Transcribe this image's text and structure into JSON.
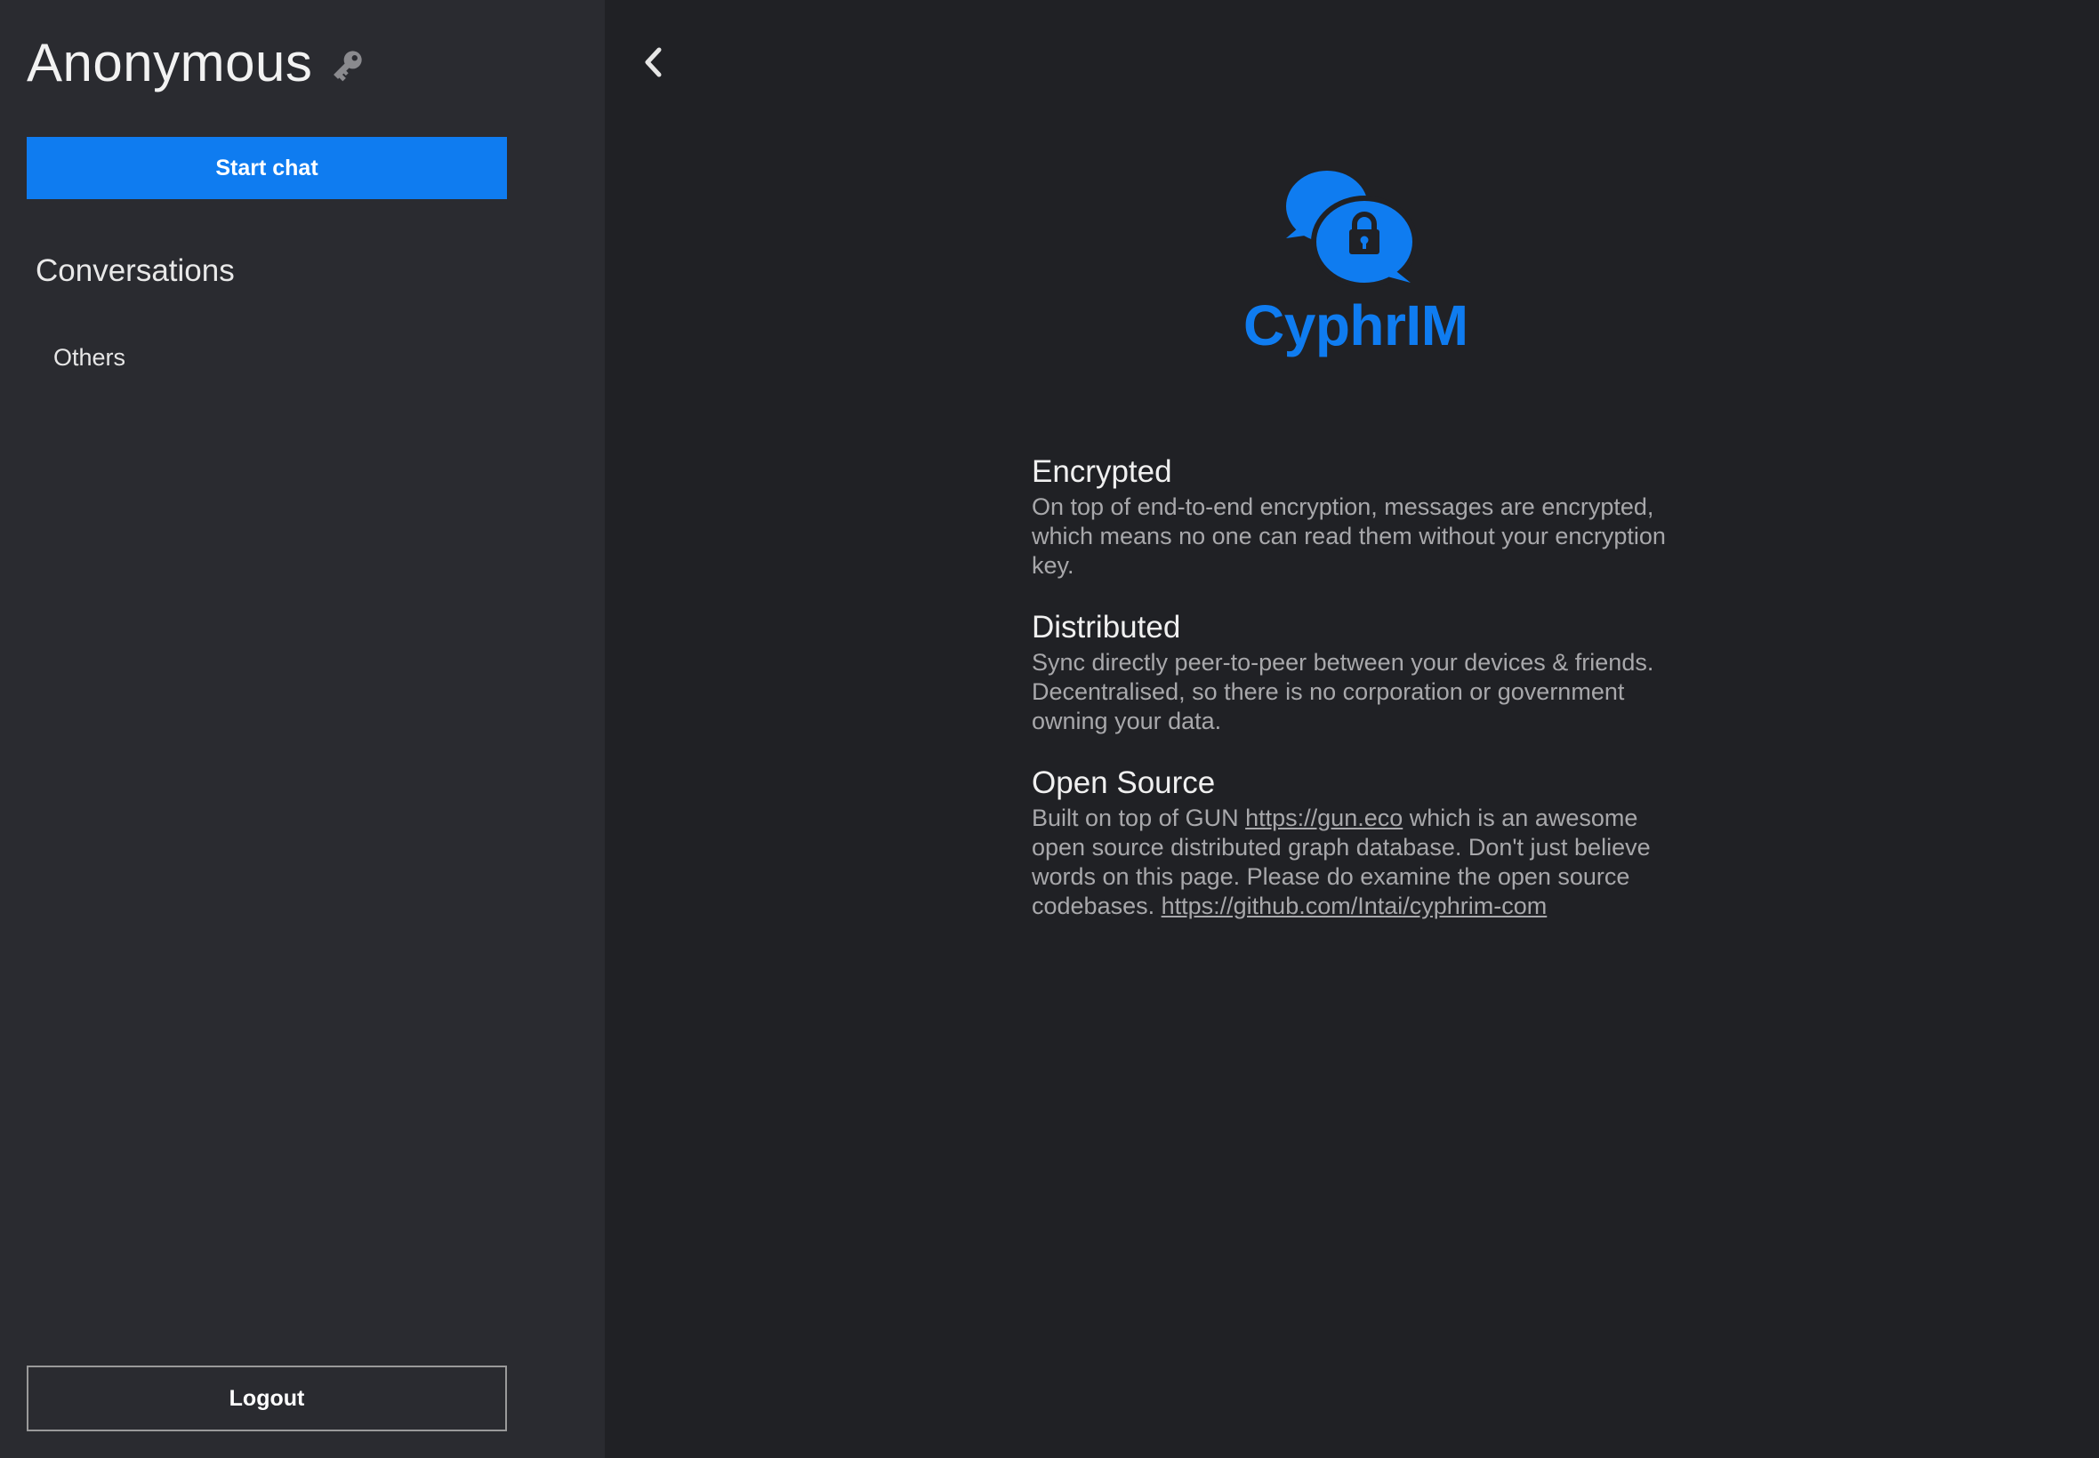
{
  "sidebar": {
    "user_name": "Anonymous",
    "key_icon": "key-icon",
    "start_chat_label": "Start chat",
    "conversations_heading": "Conversations",
    "conversation_items": [
      "Others"
    ],
    "logout_label": "Logout"
  },
  "main": {
    "back_icon": "chevron-left-icon",
    "logo": {
      "text": "CyphrIM",
      "icon": "chat-bubbles-lock-icon",
      "color": "#0f7cf0"
    },
    "features": [
      {
        "title": "Encrypted",
        "text": "On top of end-to-end encryption, messages are encrypted, which means no one can read them without your encryption key."
      },
      {
        "title": "Distributed",
        "text": "Sync directly peer-to-peer between your devices & friends. Decentralised, so there is no corporation or government owning your data."
      },
      {
        "title": "Open Source",
        "text_before": "Built on top of GUN ",
        "link1": "https://gun.eco",
        "text_middle": " which is an awesome open source distributed graph database. Don't just believe words on this page. Please do examine the open source codebases. ",
        "link2": "https://github.com/Intai/cyphrim-com"
      }
    ]
  },
  "colors": {
    "accent": "#0f7cf0",
    "sidebar_bg": "#2a2b30",
    "main_bg": "#202125"
  }
}
